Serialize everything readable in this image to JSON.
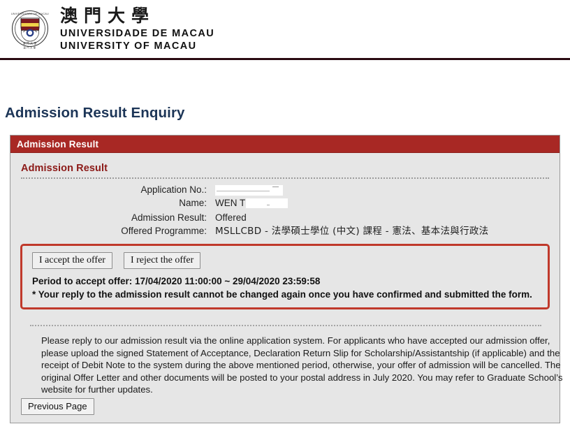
{
  "banner": {
    "crest_alt": "university-crest",
    "name_cn": "澳門大學",
    "name_pt": "UNIVERSIDADE DE MACAU",
    "name_en": "UNIVERSITY OF MACAU"
  },
  "page": {
    "title": "Admission Result Enquiry"
  },
  "panel": {
    "header_label": "Admission Result",
    "section_title": "Admission Result",
    "fields": [
      {
        "label": "Application No.:",
        "value": "",
        "redacted": true
      },
      {
        "label": "Name:",
        "value": "WEN T",
        "redacted": true
      },
      {
        "label": "Admission Result:",
        "value": "Offered",
        "redacted": false
      },
      {
        "label": "Offered Programme:",
        "value": "MSLLCBD - 法學碩士學位 (中文) 課程 - 憲法、基本法與行政法",
        "redacted": false
      }
    ]
  },
  "alert": {
    "accept_label": "I accept the offer",
    "reject_label": "I reject the offer",
    "period_text": "Period to accept offer: 17/04/2020 11:00:00 ~ 29/04/2020 23:59:58",
    "warning_text": "* Your reply to the admission result cannot be changed again once you have confirmed and submitted the form.",
    "border_color": "#c0392b"
  },
  "notice": {
    "paragraph": "Please reply to our admission result via the online application system. For applicants who have accepted our admission offer, please upload the signed Statement of Acceptance, Declaration Return Slip for Scholarship/Assistantship (if applicable) and the receipt of Debit Note to the system during the above mentioned period, otherwise, your offer of admission will be cancelled. The original Offer Letter and other documents will be posted to your postal address in July 2020. You may refer to Graduate School’s website for further updates."
  },
  "footer": {
    "previous_page_label": "Previous Page"
  },
  "colors": {
    "header_bar": "#a82824",
    "title": "#1c3557",
    "section_title": "#8c1a18",
    "panel_bg": "#e6e6e6",
    "alert_border": "#c0392b"
  }
}
